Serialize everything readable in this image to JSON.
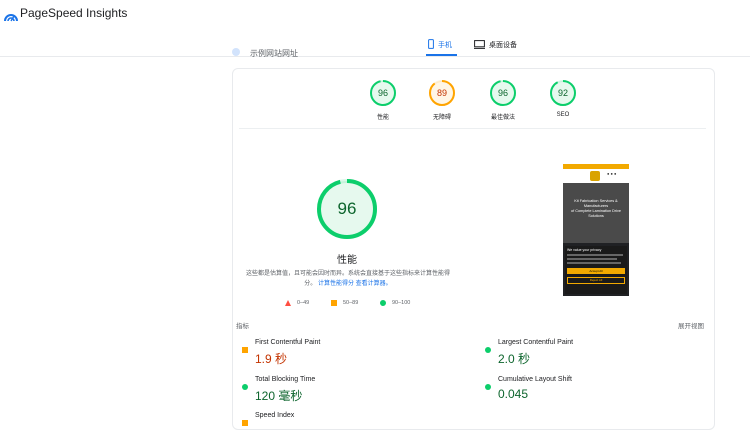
{
  "header": {
    "app_title": "PageSpeed Insights"
  },
  "tabs": [
    {
      "label": "手机",
      "active": true
    },
    {
      "label": "桌面设备",
      "active": false
    }
  ],
  "url_text": "示例网站网址",
  "categories": [
    {
      "label": "性能",
      "score": "96",
      "status": "pass"
    },
    {
      "label": "无障碍",
      "score": "89",
      "status": "average"
    },
    {
      "label": "最佳做法",
      "score": "96",
      "status": "pass"
    },
    {
      "label": "SEO",
      "score": "92",
      "status": "pass"
    }
  ],
  "main_score": {
    "score": "96",
    "title": "性能"
  },
  "description": {
    "text": "这些都是估算值，且可能会因时而异。系统会直接基于这些指标来计算性能得分。",
    "link1": "计算性能得分",
    "link2": "查看计算器。"
  },
  "legend": [
    {
      "label": "0–49",
      "status": "fail"
    },
    {
      "label": "50–89",
      "status": "average"
    },
    {
      "label": "90–100",
      "status": "pass"
    }
  ],
  "screenshot": {
    "topbar": "● ● ●",
    "hero_lines": [
      "Kit Fabrication Services &",
      "Manufacturers",
      "of Complete Lamination Drive",
      "Solutions"
    ],
    "cookie_title": "We value your privacy",
    "btn1": "Accept All",
    "btn2": "Reject All"
  },
  "metrics_label": "指标",
  "expand_label": "展开视图",
  "metrics": [
    {
      "name": "First Contentful Paint",
      "value": "1.9 秒",
      "status": "average"
    },
    {
      "name": "Largest Contentful Paint",
      "value": "2.0 秒",
      "status": "pass"
    },
    {
      "name": "Total Blocking Time",
      "value": "120 毫秒",
      "status": "pass"
    },
    {
      "name": "Cumulative Layout Shift",
      "value": "0.045",
      "status": "pass"
    },
    {
      "name": "Speed Index",
      "value": "",
      "status": "average"
    }
  ],
  "colors": {
    "pass": "#0cce6b",
    "pass_text": "#0d652d",
    "average": "#ffa400",
    "average_text": "#c33300",
    "fail": "#ff4e42",
    "accent": "#1a73e8"
  }
}
